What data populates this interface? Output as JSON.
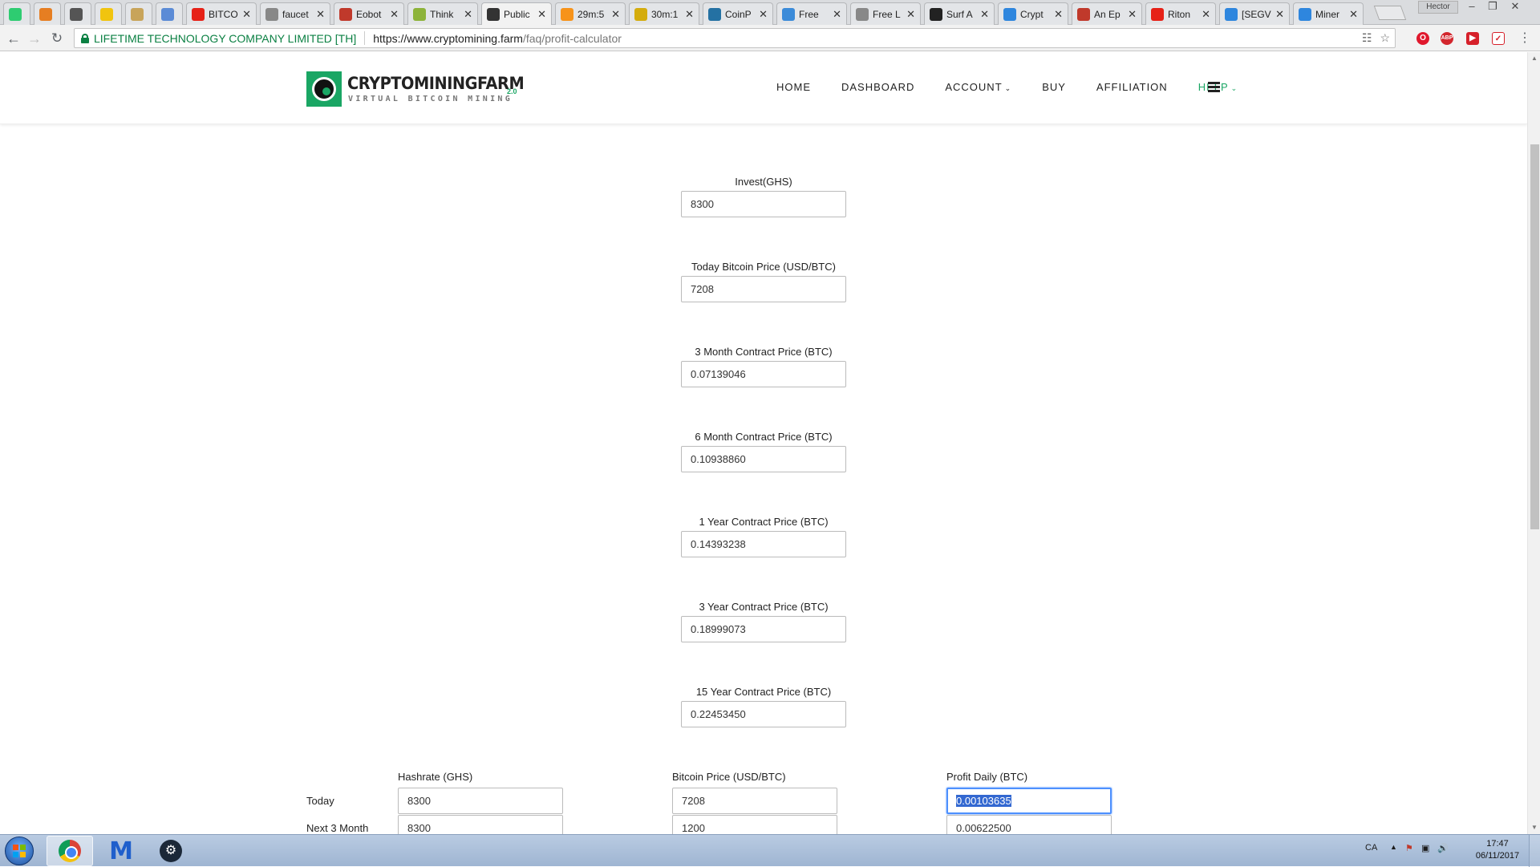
{
  "browser": {
    "tabs": [
      {
        "label": "",
        "favicon": "crypto-app-icon",
        "color": "#2ecc71"
      },
      {
        "label": "",
        "favicon": "fox-icon",
        "color": "#e67e22"
      },
      {
        "label": "",
        "favicon": "b-icon",
        "color": "#555555"
      },
      {
        "label": "",
        "favicon": "coin-icon",
        "color": "#f1c40f"
      },
      {
        "label": "",
        "favicon": "bulb-icon",
        "color": "#c8a45a"
      },
      {
        "label": "",
        "favicon": "bars-icon",
        "color": "#5b8bd6"
      },
      {
        "label": "BITCO",
        "favicon": "youtube-icon",
        "color": "#e62117"
      },
      {
        "label": "faucet",
        "favicon": "page-icon",
        "color": "#888888"
      },
      {
        "label": "Eobot",
        "favicon": "eobot-icon",
        "color": "#c0392b"
      },
      {
        "label": "Think",
        "favicon": "think-icon",
        "color": "#8db33a"
      },
      {
        "label": "Public",
        "favicon": "btc-icon",
        "color": "#333333",
        "active": true
      },
      {
        "label": "29m:5",
        "favicon": "bitcoin-icon",
        "color": "#f7931a"
      },
      {
        "label": "30m:1",
        "favicon": "dollar-icon",
        "color": "#d4ac0d"
      },
      {
        "label": "CoinP",
        "favicon": "coinpot-icon",
        "color": "#2471a3"
      },
      {
        "label": "Free",
        "favicon": "bubbles-icon",
        "color": "#3b8bd9"
      },
      {
        "label": "Free L",
        "favicon": "litecoin-icon",
        "color": "#888888"
      },
      {
        "label": "Surf A",
        "favicon": "surf-icon",
        "color": "#222222"
      },
      {
        "label": "Crypt",
        "favicon": "crypto-c-icon",
        "color": "#2e86de"
      },
      {
        "label": "An Ep",
        "favicon": "puzzle-icon",
        "color": "#c0392b"
      },
      {
        "label": "Riton",
        "favicon": "youtube-icon",
        "color": "#e62117"
      },
      {
        "label": "[SEGV",
        "favicon": "b-blue-icon",
        "color": "#2e86de"
      },
      {
        "label": "Miner",
        "favicon": "miner-icon",
        "color": "#2e86de"
      }
    ],
    "user_badge": "Hector",
    "address_bar": {
      "ev_name": "LIFETIME TECHNOLOGY COMPANY LIMITED [TH]",
      "url_host": "https://www.cryptomining.farm",
      "url_path": "/faq/profit-calculator"
    }
  },
  "site": {
    "logo_text": "CRYPTOMININGFARM",
    "logo_tagline": "VIRTUAL BITCOIN MINING",
    "logo_version": "2.0",
    "accent_color": "#1aa664",
    "nav": [
      {
        "label": "HOME",
        "dropdown": false
      },
      {
        "label": "DASHBOARD",
        "dropdown": false
      },
      {
        "label": "ACCOUNT",
        "dropdown": true
      },
      {
        "label": "BUY",
        "dropdown": false
      },
      {
        "label": "AFFILIATION",
        "dropdown": false
      },
      {
        "label": "HELP",
        "dropdown": true,
        "active": true
      }
    ]
  },
  "calculator": {
    "fields": [
      {
        "label": "Invest(GHS)",
        "value": "8300"
      },
      {
        "label": "Today Bitcoin Price (USD/BTC)",
        "value": "7208"
      },
      {
        "label": "3 Month Contract Price (BTC)",
        "value": "0.07139046"
      },
      {
        "label": "6 Month Contract Price (BTC)",
        "value": "0.10938860"
      },
      {
        "label": "1 Year Contract Price (BTC)",
        "value": "0.14393238"
      },
      {
        "label": "3 Year Contract Price (BTC)",
        "value": "0.18999073"
      },
      {
        "label": "15 Year Contract Price (BTC)",
        "value": "0.22453450"
      }
    ],
    "table": {
      "columns": [
        "Hashrate (GHS)",
        "Bitcoin Price (USD/BTC)",
        "Profit Daily (BTC)"
      ],
      "rows": [
        {
          "label": "Today",
          "values": [
            "8300",
            "7208",
            "0.00103635"
          ]
        },
        {
          "label": "Next 3 Month",
          "values": [
            "8300",
            "1200",
            "0.00622500"
          ]
        }
      ]
    }
  },
  "taskbar": {
    "apps": [
      {
        "name": "chrome",
        "active": true
      },
      {
        "name": "malwarebytes",
        "active": false
      },
      {
        "name": "steam",
        "active": false
      }
    ],
    "language": "CA",
    "time": "17:47",
    "date": "06/11/2017"
  }
}
